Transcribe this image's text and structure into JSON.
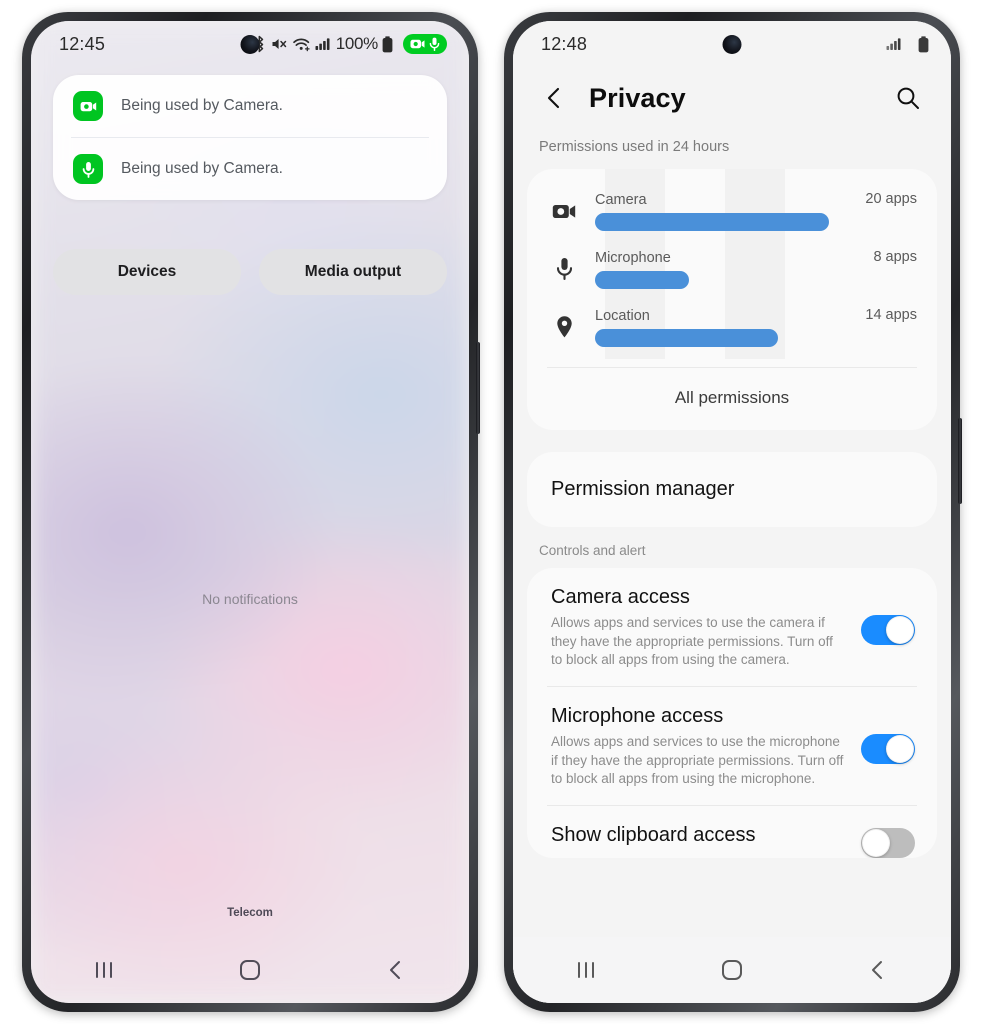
{
  "left_phone": {
    "status_bar": {
      "clock": "12:45",
      "battery_percent": "100%",
      "icons": [
        "bluetooth-icon",
        "mute-icon",
        "wifi-icon",
        "signal-icon",
        "battery-icon"
      ],
      "privacy_pill": [
        "camera-icon",
        "microphone-icon"
      ]
    },
    "notifications": [
      {
        "icon": "camera-icon",
        "text": "Being used by Camera."
      },
      {
        "icon": "microphone-icon",
        "text": "Being used by Camera."
      }
    ],
    "quick_buttons": [
      {
        "label": "Devices"
      },
      {
        "label": "Media output"
      }
    ],
    "empty_state": "No notifications",
    "carrier": "Telecom",
    "nav_bar": [
      "recents-icon",
      "home-icon",
      "back-icon"
    ]
  },
  "right_phone": {
    "status_bar": {
      "clock": "12:48",
      "icons": [
        "signal-icon",
        "battery-icon"
      ]
    },
    "app_bar": {
      "back_label": "back-icon",
      "title": "Privacy",
      "search_label": "search-icon"
    },
    "usage_section": {
      "caption": "Permissions used in 24 hours",
      "all_permissions_label": "All permissions"
    },
    "permission_manager": {
      "label": "Permission manager"
    },
    "controls_section": {
      "label": "Controls and alert",
      "items": [
        {
          "title": "Camera access",
          "description": "Allows apps and services to use the camera if they have the appropriate permissions. Turn off to block all apps from using the camera.",
          "toggle": "on"
        },
        {
          "title": "Microphone access",
          "description": "Allows apps and services to use the microphone if they have the appropriate permissions. Turn off to block all apps from using the microphone.",
          "toggle": "on"
        },
        {
          "title": "Show clipboard access",
          "description": "",
          "toggle": "off"
        }
      ]
    },
    "nav_bar": [
      "recents-icon",
      "home-icon",
      "back-icon"
    ]
  },
  "chart_data": {
    "type": "bar",
    "title": "Permissions used in 24 hours",
    "orientation": "horizontal",
    "categories": [
      "Camera",
      "Microphone",
      "Location"
    ],
    "values": [
      20,
      8,
      14
    ],
    "value_labels": [
      "20 apps",
      "8 apps",
      "14 apps"
    ],
    "icons": [
      "camera-icon",
      "microphone-icon",
      "location-icon"
    ],
    "xlabel": "",
    "ylabel": "",
    "xlim": [
      0,
      24
    ],
    "bar_color": "#4a90d9",
    "grid": true,
    "legend": "none"
  },
  "colors": {
    "privacy_green": "#00cc22",
    "bar_blue": "#4a90d9",
    "toggle_on": "#1a8cff",
    "toggle_off": "#bdbdbd"
  }
}
